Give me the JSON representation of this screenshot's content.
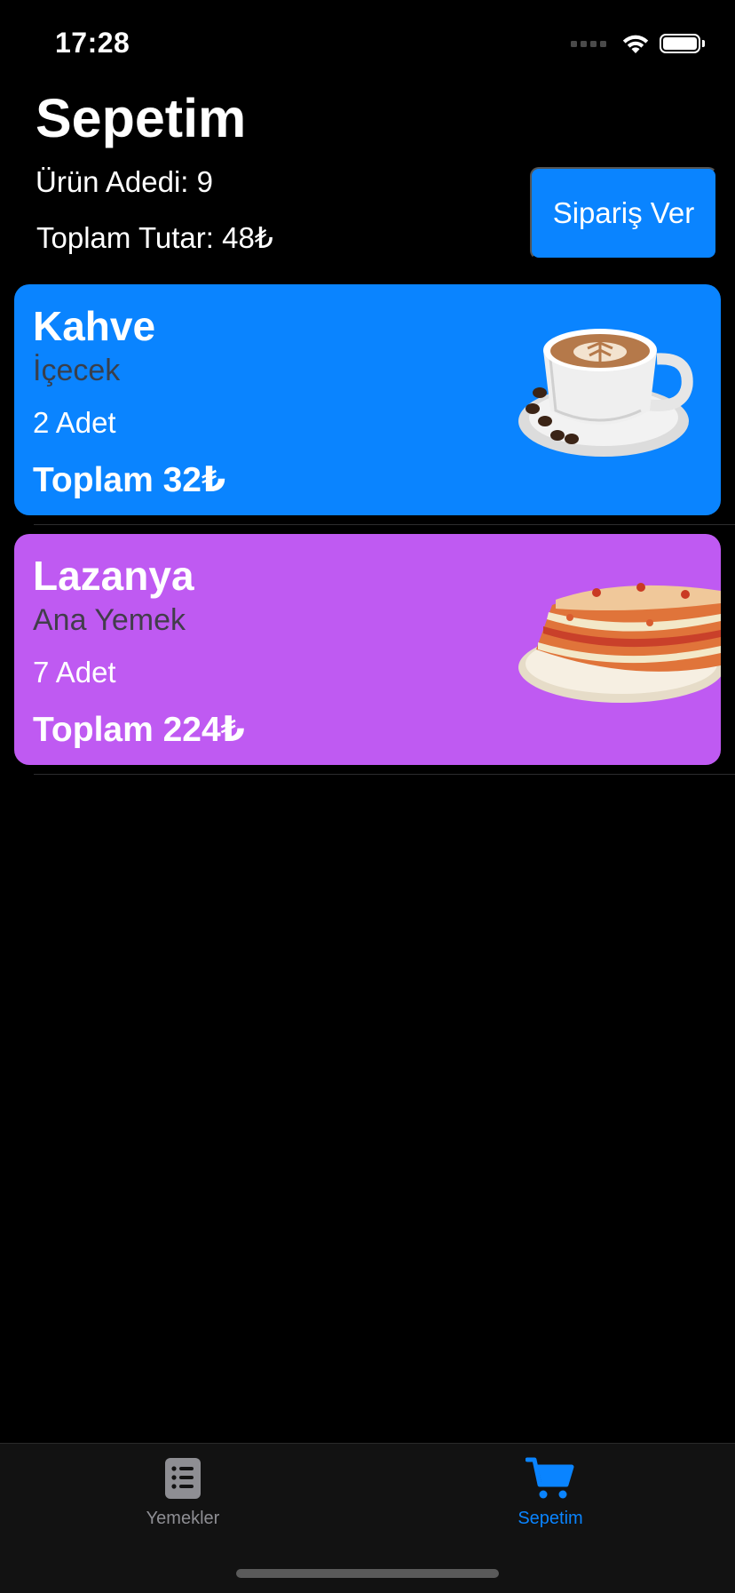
{
  "status_bar": {
    "time": "17:28"
  },
  "header": {
    "title": "Sepetim",
    "item_count": "Ürün Adedi: 9",
    "total_amount": "Toplam Tutar: 48₺",
    "order_button": "Sipariş Ver"
  },
  "cart_items": [
    {
      "name": "Kahve",
      "category": "İçecek",
      "quantity": "2 Adet",
      "total": "Toplam 32₺",
      "color": "#0a84ff",
      "image": "coffee-cup"
    },
    {
      "name": "Lazanya",
      "category": "Ana Yemek",
      "quantity": "7 Adet",
      "total": "Toplam 224₺",
      "color": "#bf5af2",
      "image": "lasagna-plate"
    }
  ],
  "tab_bar": {
    "tabs": [
      {
        "label": "Yemekler",
        "icon": "list-icon",
        "selected": false
      },
      {
        "label": "Sepetim",
        "icon": "cart-icon",
        "selected": true
      }
    ],
    "accent": "#0a84ff",
    "inactive": "#8e8e93"
  }
}
